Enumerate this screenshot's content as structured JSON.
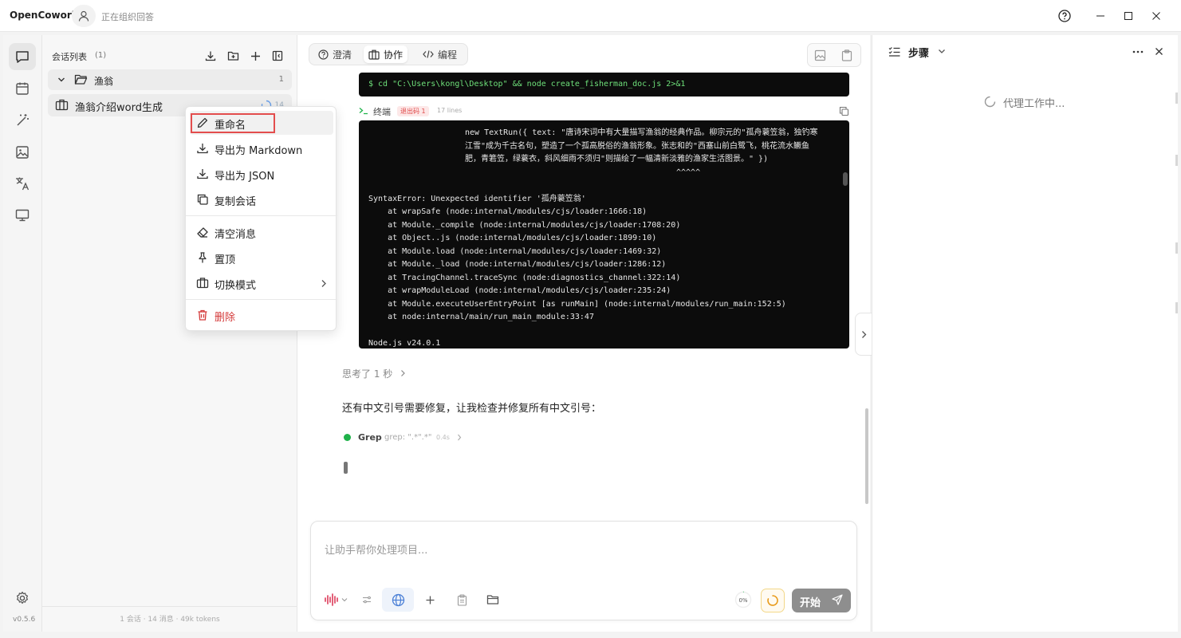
{
  "titlebar": {
    "app_name": "OpenCowork",
    "status": "正在组织回答"
  },
  "leftbar": {
    "items": [
      "chat-icon",
      "calendar-icon",
      "magic-wand-icon",
      "image-icon",
      "translate-icon",
      "monitor-icon"
    ],
    "version": "v0.5.6"
  },
  "sidebar": {
    "title": "会话列表",
    "count": "(1)",
    "folder": {
      "name": "渔翁",
      "count": "1"
    },
    "conversation": {
      "name": "渔翁介绍word生成",
      "num": "14"
    },
    "footer": "1 会话 · 14 消息 · 49k tokens"
  },
  "context_menu": {
    "rename": "重命名",
    "export_md": "导出为 Markdown",
    "export_json": "导出为 JSON",
    "copy": "复制会话",
    "clear": "清空消息",
    "pin": "置顶",
    "switch_mode": "切换模式",
    "delete": "删除"
  },
  "main": {
    "tabs": [
      {
        "label": "澄清"
      },
      {
        "label": "协作"
      },
      {
        "label": "编程"
      }
    ],
    "command": "$ cd \"C:\\Users\\kongl\\Desktop\" && node create_fisherman_doc.js 2>&1",
    "terminal": {
      "label": "终端",
      "exit_badge": "退出码 1",
      "lines": "17 lines",
      "output_wrap": "new TextRun({ text: \"唐诗宋词中有大量描写渔翁的经典作品。柳宗元的\"孤舟蓑笠翁，独钓寒江雪\"成为千古名句，塑造了一个孤高脱俗的渔翁形象。张志和的\"西塞山前白鹭飞，桃花流水鳜鱼肥，青箬笠，绿蓑衣，斜风细雨不须归\"则描绘了一幅清新淡雅的渔家生活图景。\" })",
      "caret": "^^^^^",
      "error": "SyntaxError: Unexpected identifier '孤舟蓑笠翁'",
      "stack": [
        "    at wrapSafe (node:internal/modules/cjs/loader:1666:18)",
        "    at Module._compile (node:internal/modules/cjs/loader:1708:20)",
        "    at Object..js (node:internal/modules/cjs/loader:1899:10)",
        "    at Module.load (node:internal/modules/cjs/loader:1469:32)",
        "    at Module._load (node:internal/modules/cjs/loader:1286:12)",
        "    at TracingChannel.traceSync (node:diagnostics_channel:322:14)",
        "    at wrapModuleLoad (node:internal/modules/cjs/loader:235:24)",
        "    at Module.executeUserEntryPoint [as runMain] (node:internal/modules/run_main:152:5)",
        "    at node:internal/main/run_main_module:33:47"
      ],
      "version": "Node.js v24.0.1"
    },
    "thinking": "思考了 1 秒",
    "answer": "还有中文引号需要修复，让我检查并修复所有中文引号：",
    "tool": {
      "name": "Grep",
      "args": "grep: \".*\".*\"",
      "time": "0.4s"
    },
    "composer": {
      "placeholder": "让助手帮你处理项目...",
      "context_pct": "0%",
      "start_label": "开始"
    }
  },
  "right_panel": {
    "title": "步骤",
    "status": "代理工作中..."
  },
  "colors": {
    "accent_red": "#e34d4d",
    "terminal_bg": "#0c0c0c",
    "command_green": "#6ee07a",
    "tool_green": "#1fb24a"
  }
}
